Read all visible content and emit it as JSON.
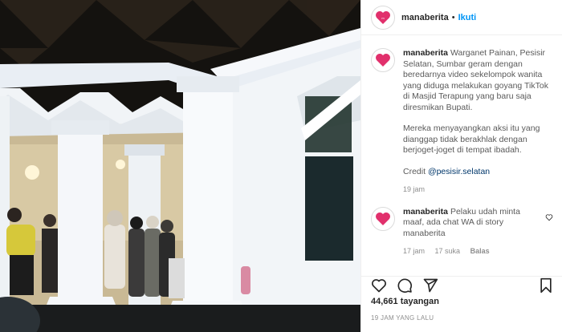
{
  "post": {
    "username": "manaberita",
    "dot": "•",
    "follow_label": "Ikuti"
  },
  "caption": {
    "username": "manaberita",
    "text1": "Warganet Painan, Pesisir Selatan, Sumbar geram dengan beredarnya video sekelompok wanita yang diduga melakukan goyang TikTok di Masjid Terapung yang baru saja diresmikan Bupati.",
    "text2": "Mereka menyayangkan aksi itu yang dianggap tidak berakhlak dengan berjoget-joget di tempat ibadah.",
    "credit_label": "Credit",
    "credit_mention": "@pesisir.selatan",
    "time": "19 jam"
  },
  "reply": {
    "username": "manaberita",
    "text": "Pelaku udah minta maaf, ada chat WA di story manaberita",
    "time": "17 jam",
    "likes": "17 suka",
    "reply_label": "Balas"
  },
  "stats": {
    "views": "44,661 tayangan",
    "posted": "19 JAM YANG LALU"
  },
  "colors": {
    "link": "#0095f6",
    "brand": "#e1306c"
  }
}
